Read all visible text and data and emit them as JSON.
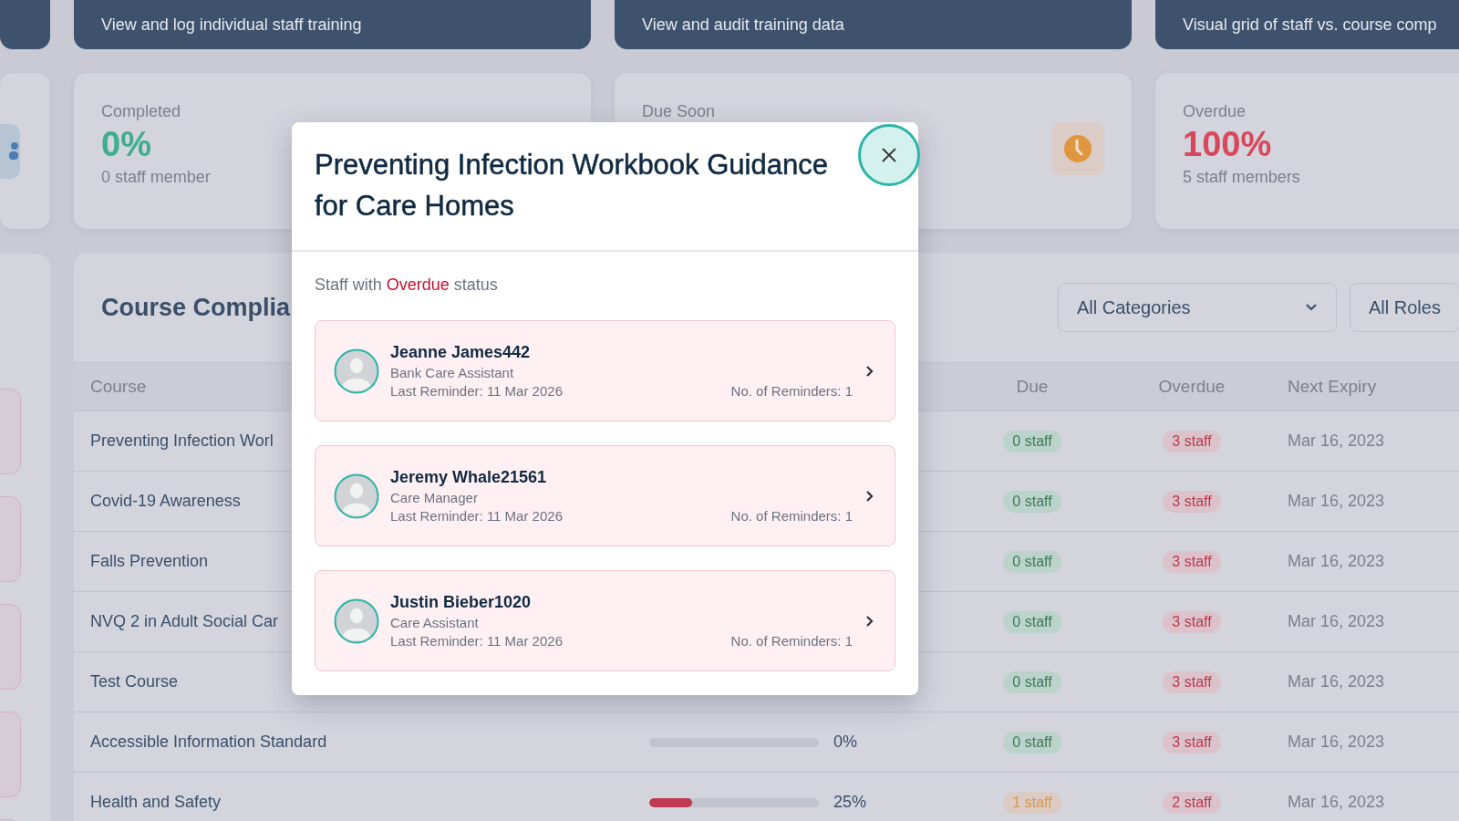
{
  "top_links": [
    {
      "text": "View and log individual staff training"
    },
    {
      "text": "View and audit training data"
    },
    {
      "text": "Visual grid of staff vs. course comp"
    }
  ],
  "stats": [
    {
      "kind": "completed",
      "label": "Completed",
      "value": "0%",
      "sub": "0 staff member"
    },
    {
      "kind": "due",
      "label": "Due Soon"
    },
    {
      "kind": "overdue",
      "label": "Overdue",
      "value": "100%",
      "sub": "5 staff members"
    }
  ],
  "compliance": {
    "title": "Course Complia",
    "filters": [
      {
        "kind": "select",
        "label": "All Categories"
      },
      {
        "kind": "plain",
        "label": "All Roles"
      }
    ],
    "columns": [
      "Course",
      "Due",
      "Overdue",
      "Next Expiry"
    ],
    "rows": [
      {
        "course": "Preventing Infection Worl",
        "due": {
          "text": "0 staff",
          "kind": "none"
        },
        "overdue": "3 staff",
        "expiry": "Mar 16, 2023"
      },
      {
        "course": "Covid-19 Awareness",
        "due": {
          "text": "0 staff",
          "kind": "none"
        },
        "overdue": "3 staff",
        "expiry": "Mar 16, 2023"
      },
      {
        "course": "Falls Prevention",
        "due": {
          "text": "0 staff",
          "kind": "none"
        },
        "overdue": "3 staff",
        "expiry": "Mar 16, 2023"
      },
      {
        "course": "NVQ 2 in Adult Social Car",
        "due": {
          "text": "0 staff",
          "kind": "none"
        },
        "overdue": "3 staff",
        "expiry": "Mar 16, 2023"
      },
      {
        "course": "Test Course",
        "due": {
          "text": "0 staff",
          "kind": "none"
        },
        "overdue": "3 staff",
        "expiry": "Mar 16, 2023"
      },
      {
        "course": "Accessible Information Standard",
        "progress": {
          "level": 0,
          "reading": "0%"
        },
        "due": {
          "text": "0 staff",
          "kind": "none"
        },
        "overdue": "3 staff",
        "expiry": "Mar 16, 2023"
      },
      {
        "course": "Health and Safety",
        "progress": {
          "level": 0.25,
          "reading": "25%"
        },
        "due": {
          "text": "1 staff",
          "kind": "some"
        },
        "overdue": "2 staff",
        "expiry": "Mar 16, 2023"
      }
    ]
  },
  "modal": {
    "title": "Preventing Infection Workbook Guidance for Care Homes",
    "subtitle": {
      "before": "Staff with",
      "status": "Overdue",
      "after": "status"
    },
    "staff": [
      {
        "name": "Jeanne James442",
        "role": "Bank Care Assistant",
        "last_reminder": "Last Reminder: 11 Mar 2026",
        "reminders": "No. of Reminders: 1"
      },
      {
        "name": "Jeremy Whale21561",
        "role": "Care Manager",
        "last_reminder": "Last Reminder: 11 Mar 2026",
        "reminders": "No. of Reminders: 1"
      },
      {
        "name": "Justin Bieber1020",
        "role": "Care Assistant",
        "last_reminder": "Last Reminder: 11 Mar 2026",
        "reminders": "No. of Reminders: 1"
      }
    ]
  }
}
